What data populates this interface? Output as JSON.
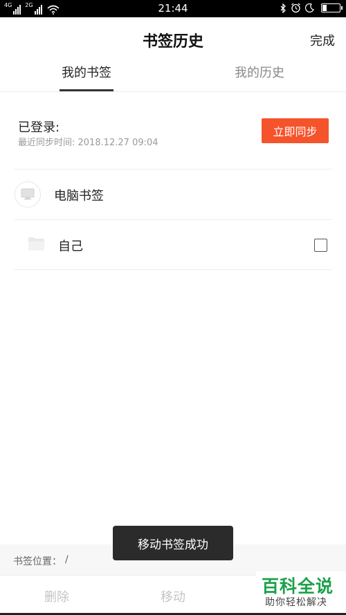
{
  "status_bar": {
    "net1": "4G",
    "net2": "2G",
    "time": "21:44",
    "icons": [
      "bluetooth-icon",
      "alarm-icon",
      "moon-icon",
      "battery-icon"
    ],
    "battery_level": 0.25
  },
  "header": {
    "title": "书签历史",
    "done_label": "完成"
  },
  "tabs": [
    {
      "label": "我的书签",
      "active": true
    },
    {
      "label": "我的历史",
      "active": false
    }
  ],
  "sync": {
    "status": "已登录:",
    "last_sync": "最近同步时间: 2018.12.27 09:04",
    "button_label": "立即同步",
    "button_color": "#f5532c"
  },
  "bookmarks": {
    "pc_label": "电脑书签",
    "folder_label": "自己",
    "pc_icon": "monitor-icon",
    "folder_icon": "folder-icon"
  },
  "toast": {
    "message": "移动书签成功"
  },
  "location": {
    "label": "书签位置：",
    "value": "/"
  },
  "bottom_bar": {
    "delete_label": "删除",
    "move_label": "移动"
  },
  "watermark": {
    "main": "百科全说",
    "sub": "助你轻松解决",
    "color": "#1aa14a"
  }
}
